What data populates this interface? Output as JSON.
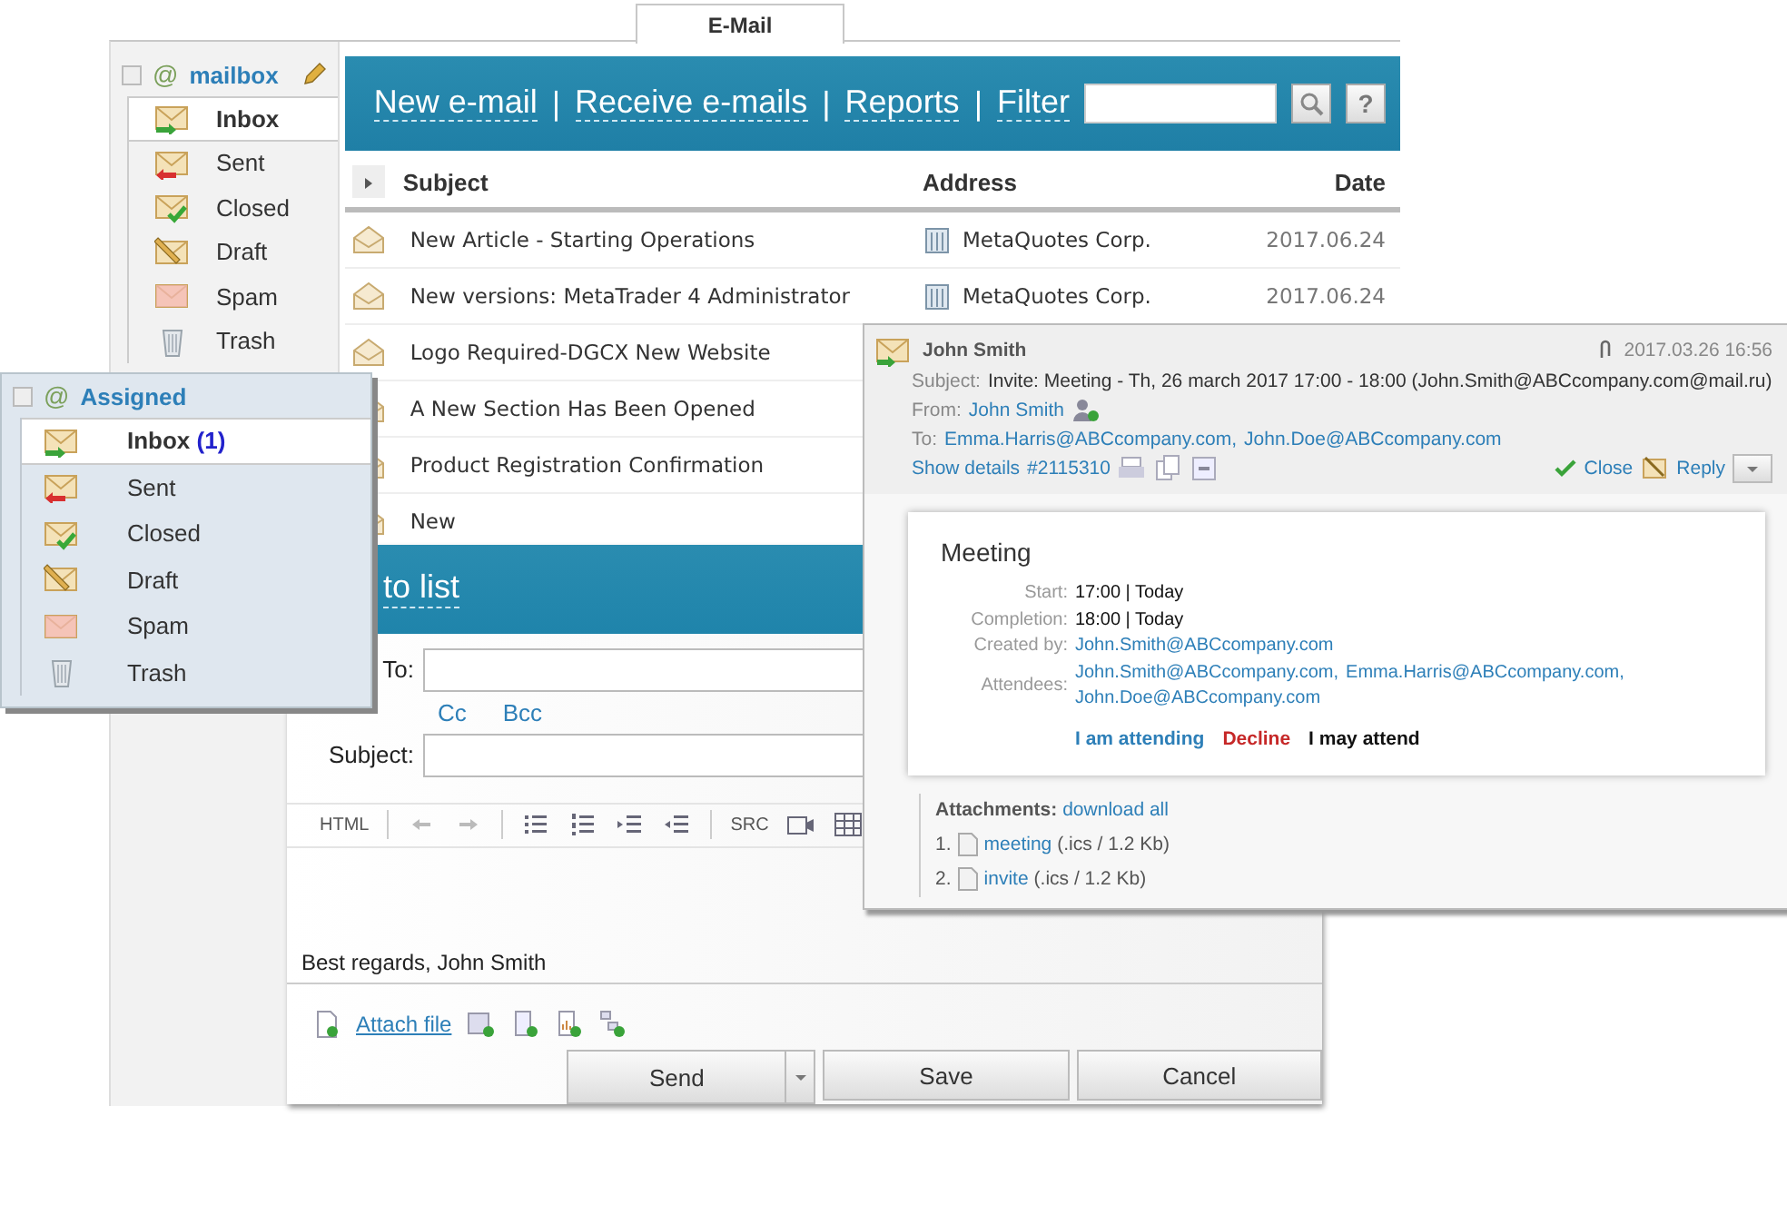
{
  "tab": {
    "label": "E-Mail",
    "selected": true
  },
  "mailbox": {
    "icon_text": "@",
    "title": "mailbox",
    "folders": [
      {
        "label": "Inbox",
        "kind": "inbox",
        "selected": true
      },
      {
        "label": "Sent",
        "kind": "sent",
        "selected": false
      },
      {
        "label": "Closed",
        "kind": "closed",
        "selected": false
      },
      {
        "label": "Draft",
        "kind": "draft",
        "selected": false
      },
      {
        "label": "Spam",
        "kind": "spam",
        "selected": false
      },
      {
        "label": "Trash",
        "kind": "trash",
        "selected": false
      }
    ]
  },
  "toolbar": {
    "items": [
      {
        "kind": "link",
        "text": "New e-mail"
      },
      {
        "kind": "separator",
        "text": "|"
      },
      {
        "kind": "link",
        "text": "Receive e-mails"
      },
      {
        "kind": "separator",
        "text": "|"
      },
      {
        "kind": "link",
        "text": "Reports"
      },
      {
        "kind": "separator",
        "text": "|"
      },
      {
        "kind": "link",
        "text": "Filter"
      }
    ],
    "help": "?"
  },
  "table": {
    "columns": [
      "Subject",
      "Address",
      "Date"
    ],
    "rows": [
      {
        "subject": "New Article - Starting Operations",
        "address": "MetaQuotes Corp.",
        "date": "2017.06.24"
      },
      {
        "subject": "New versions: MetaTrader 4 Administrator",
        "address": "MetaQuotes Corp.",
        "date": "2017.06.24"
      },
      {
        "subject": "Logo Required-DGCX New Website"
      },
      {
        "subject": "A New Section Has Been Opened"
      },
      {
        "subject": "Product Registration Confirmation"
      },
      {
        "subject": "New"
      }
    ]
  },
  "assigned": {
    "icon_text": "@",
    "title": "Assigned",
    "folders": [
      {
        "label": "Inbox",
        "count": "(1)",
        "kind": "inbox",
        "selected": true
      },
      {
        "label": "Sent",
        "kind": "sent",
        "selected": false
      },
      {
        "label": "Closed",
        "kind": "closed",
        "selected": false
      },
      {
        "label": "Draft",
        "kind": "draft",
        "selected": false
      },
      {
        "label": "Spam",
        "kind": "spam",
        "selected": false
      },
      {
        "label": "Trash",
        "kind": "trash",
        "selected": false
      }
    ]
  },
  "compose": {
    "title": "to list",
    "to_label": "To:",
    "cc": "Cc",
    "bcc": "Bcc",
    "subject_label": "Subject:",
    "html_label": "HTML",
    "src_label": "SRC",
    "body": "Best regards, John Smith",
    "attach": "Attach file",
    "buttons": [
      "Send",
      "Save",
      "Cancel"
    ]
  },
  "message": {
    "sender": "John Smith",
    "date": "2017.03.26 16:56",
    "subject_label": "Subject:",
    "subject": "Invite: Meeting - Th, 26 march 2017 17:00 - 18:00 (John.Smith@ABCcompany.com@mail.ru)",
    "from_label": "From:",
    "from": "John Smith",
    "to_label": "To:",
    "to": [
      "Emma.Harris@ABCcompany.com,",
      "John.Doe@ABCcompany.com"
    ],
    "details": "Show details",
    "number": "#2115310",
    "close": "Close",
    "reply": "Reply",
    "meeting": {
      "title": "Meeting",
      "fields": [
        {
          "label": "Start:",
          "kind": "text",
          "values": [
            "17:00 | Today"
          ]
        },
        {
          "label": "Completion:",
          "kind": "text",
          "values": [
            "18:00 | Today"
          ]
        },
        {
          "label": "Created by:",
          "kind": "links",
          "values": [
            "John.Smith@ABCcompany.com"
          ]
        },
        {
          "label": "Attendees:",
          "kind": "links",
          "values": [
            "John.Smith@ABCcompany.com,",
            "Emma.Harris@ABCcompany.com,",
            "John.Doe@ABCcompany.com"
          ]
        }
      ],
      "actions": [
        {
          "text": "I am attending",
          "kind": "accept"
        },
        {
          "text": "Decline",
          "kind": "decline"
        },
        {
          "text": "I may attend",
          "kind": "maybe"
        }
      ]
    },
    "attachments": {
      "label": "Attachments:",
      "download": "download all",
      "files": [
        {
          "index": "1.",
          "name": "meeting",
          "info": "(.ics / 1.2 Kb)"
        },
        {
          "index": "2.",
          "name": "invite",
          "info": "(.ics / 1.2 Kb)"
        }
      ]
    }
  }
}
